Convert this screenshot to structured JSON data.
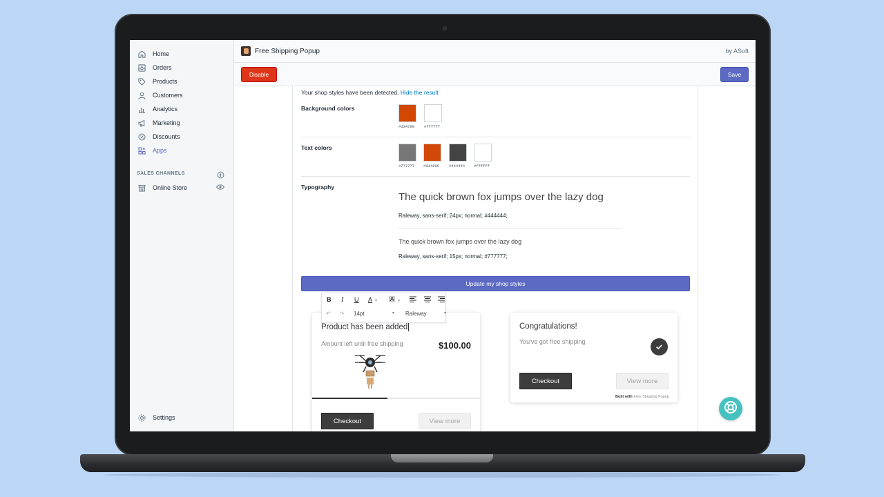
{
  "sidebar": {
    "items": [
      {
        "label": "Home",
        "icon": "home-icon"
      },
      {
        "label": "Orders",
        "icon": "orders-icon"
      },
      {
        "label": "Products",
        "icon": "tag-icon"
      },
      {
        "label": "Customers",
        "icon": "user-icon"
      },
      {
        "label": "Analytics",
        "icon": "bar-chart-icon"
      },
      {
        "label": "Marketing",
        "icon": "megaphone-icon"
      },
      {
        "label": "Discounts",
        "icon": "discount-icon"
      },
      {
        "label": "Apps",
        "icon": "apps-icon"
      }
    ],
    "sales_channels_label": "SALES CHANNELS",
    "online_store_label": "Online Store",
    "settings_label": "Settings"
  },
  "topbar": {
    "app_title": "Free Shipping Popup",
    "by_line": "by ASoft",
    "disable_label": "Disable",
    "save_label": "Save"
  },
  "content": {
    "detect_message": "Your shop styles have been detected.",
    "hide_link": "Hide the result",
    "background_label": "Background colors",
    "background_colors": [
      {
        "hex": "#d34700",
        "label": "#d34700"
      },
      {
        "hex": "#ffffff",
        "label": "#ffffff"
      }
    ],
    "text_label": "Text colors",
    "text_colors": [
      {
        "hex": "#777777",
        "label": "#777777"
      },
      {
        "hex": "#d14809",
        "label": "#d14809"
      },
      {
        "hex": "#444444",
        "label": "#444444"
      },
      {
        "hex": "#ffffff",
        "label": "#ffffff"
      }
    ],
    "typography_label": "Typography",
    "typo_sample_large": "The quick brown fox jumps over the lazy dog",
    "typo_spec_large": "Raleway, sans-serif; 24px; normal; #444444;",
    "typo_sample_small": "The quick brown fox jumps over the lazy dog",
    "typo_spec_small": "Raleway, sans-serif; 15px; normal; #777777;",
    "update_button": "Update my shop styles"
  },
  "editor_toolbar": {
    "font_size": "14pt",
    "font_family": "Raleway"
  },
  "popup_product": {
    "title": "Product has been added",
    "subtitle": "Amount left until free shipping",
    "amount": "$100.00",
    "progress": 0.45,
    "checkout_label": "Checkout",
    "view_more_label": "View more"
  },
  "popup_congrats": {
    "title": "Congratulations!",
    "subtitle": "You've got free shipping",
    "checkout_label": "Checkout",
    "view_more_label": "View more",
    "built_with_prefix": "Built with",
    "built_with_name": "Free Shipping Popup"
  },
  "colors": {
    "accent": "#5c6ac4",
    "danger": "#de3618",
    "help": "#47c1bf"
  }
}
